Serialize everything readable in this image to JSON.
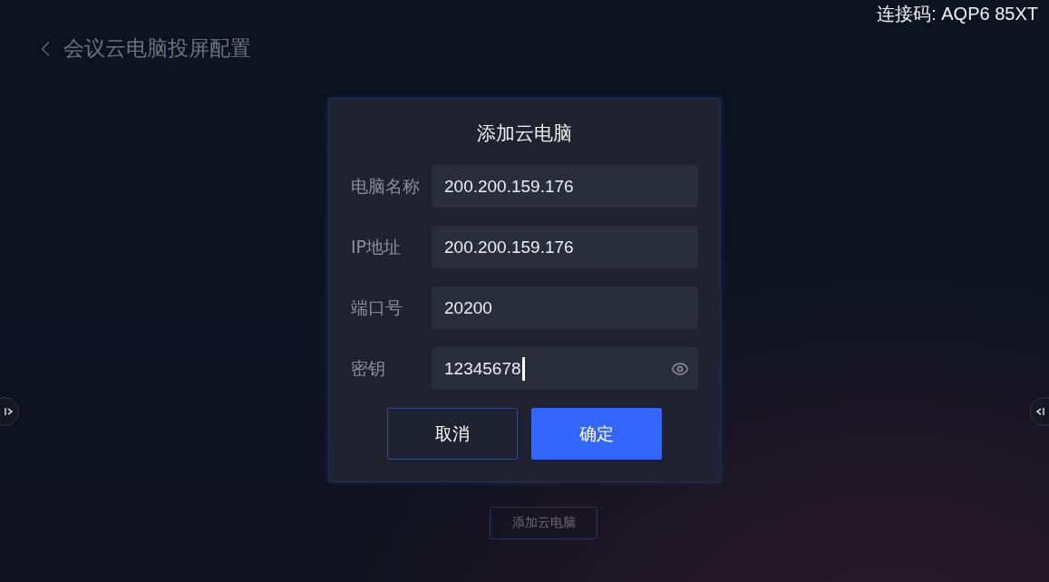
{
  "header": {
    "title": "会议云电脑投屏配置"
  },
  "connection_code": "连接码: AQP6 85XT",
  "page_button": "添加云电脑",
  "dialog": {
    "title": "添加云电脑",
    "fields": [
      {
        "label": "电脑名称",
        "value": "200.200.159.176",
        "kind": "text",
        "focused": false
      },
      {
        "label": "IP地址",
        "value": "200.200.159.176",
        "kind": "text",
        "focused": false
      },
      {
        "label": "端口号",
        "value": "20200",
        "kind": "text",
        "focused": false
      },
      {
        "label": "密钥",
        "value": "12345678",
        "kind": "password",
        "focused": true
      }
    ],
    "buttons": [
      {
        "label": "取消",
        "kind": "secondary"
      },
      {
        "label": "确定",
        "kind": "primary"
      }
    ]
  }
}
